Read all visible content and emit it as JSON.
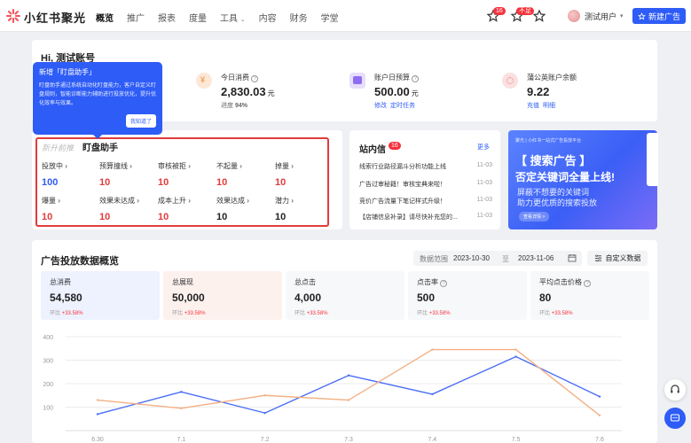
{
  "header": {
    "brand": "小红书聚光",
    "nav": [
      "概览",
      "推广",
      "报表",
      "度量",
      "工具",
      "内容",
      "财务",
      "学堂"
    ],
    "icon_badges": [
      "16",
      "不足"
    ],
    "user": "测试用户",
    "new_ad_button": "新建广告"
  },
  "account": {
    "greeting": "Hi, 测试账号",
    "stats": [
      {
        "label": "今日消费",
        "value": "2,830.03",
        "unit": "元",
        "sub_label": "进度",
        "sub_value": "94%"
      },
      {
        "label": "账户日预算",
        "value": "500.00",
        "unit": "元",
        "links": [
          "修改",
          "定时任务"
        ]
      },
      {
        "label": "蒲公英账户余额",
        "value": "9.22",
        "links": [
          "充值",
          "明细"
        ]
      }
    ]
  },
  "tooltip": {
    "title": "新增「盯盘助手」",
    "body": "盯盘助手通过系统自动化盯盘能力，客户自定义盯盘规则，智能诊断能力辅助进行投放优化，提升优化效率与效果。",
    "button": "我知道了"
  },
  "monitor": {
    "tag": "新升前推",
    "title": "盯盘助手",
    "metrics": [
      {
        "label": "投放中",
        "value": "100",
        "highlight": true
      },
      {
        "label": "预算撞线",
        "value": "10"
      },
      {
        "label": "审核被拒",
        "value": "10"
      },
      {
        "label": "不起量",
        "value": "10"
      },
      {
        "label": "掉量",
        "value": "10"
      },
      {
        "label": "爆量",
        "value": "10"
      },
      {
        "label": "效果未达成",
        "value": "10"
      },
      {
        "label": "成本上升",
        "value": "10"
      },
      {
        "label": "效果达成",
        "value": "10",
        "neutral": true
      },
      {
        "label": "潜力",
        "value": "10",
        "neutral": true
      }
    ]
  },
  "inbox": {
    "title": "站内信",
    "badge": "16",
    "more": "更多",
    "messages": [
      {
        "text": "线索行业路径漏斗分析功能上线",
        "date": "11-03"
      },
      {
        "text": "广告过审秘籍！审核宝典来啦！",
        "date": "11-03"
      },
      {
        "text": "竞价广告流量下笔记样式升级！",
        "date": "11-03"
      },
      {
        "text": "【店铺信息补录】请尽快补充您的...",
        "date": "11-03"
      }
    ]
  },
  "banner": {
    "head": "聚光 | 小红书一站式广告投放平台",
    "line1": "【 搜索广告 】",
    "line2": "否定关键词全量上线!",
    "desc1": "屏蔽不想要的关键词",
    "desc2": "助力更优质的搜索投放",
    "button": "查看详情 >"
  },
  "overview": {
    "title": "广告投放数据概览",
    "range_label": "数据范围",
    "date_start": "2023-10-30",
    "date_sep": "至",
    "date_end": "2023-11-06",
    "custom_button": "自定义数据",
    "kpis": [
      {
        "label": "总消费",
        "value": "54,580",
        "trend_label": "环比",
        "trend": "+33.58%",
        "bg": "#eef2ff"
      },
      {
        "label": "总展现",
        "value": "50,000",
        "trend_label": "环比",
        "trend": "+33.58%",
        "bg": "#fdf1ee"
      },
      {
        "label": "总点击",
        "value": "4,000",
        "trend_label": "环比",
        "trend": "+33.58%",
        "bg": "#f7f8fa"
      },
      {
        "label": "点击率",
        "value": "500",
        "trend_label": "环比",
        "trend": "+33.58%",
        "bg": "#f7f8fa"
      },
      {
        "label": "平均点击价格",
        "value": "80",
        "trend_label": "环比",
        "trend": "+33.58%",
        "bg": "#f7f8fa"
      }
    ]
  },
  "chart_data": {
    "type": "line",
    "x": [
      "6.30",
      "7.1",
      "7.2",
      "7.3",
      "7.4",
      "7.5",
      "7.6"
    ],
    "yticks": [
      100,
      200,
      300,
      400
    ],
    "ylim": [
      0,
      400
    ],
    "grid": true,
    "series": [
      {
        "values": [
          70,
          165,
          75,
          235,
          155,
          315,
          145
        ],
        "color": "#4a6ef5"
      },
      {
        "values": [
          130,
          95,
          150,
          130,
          345,
          345,
          65
        ],
        "color": "#f3b084"
      }
    ]
  }
}
